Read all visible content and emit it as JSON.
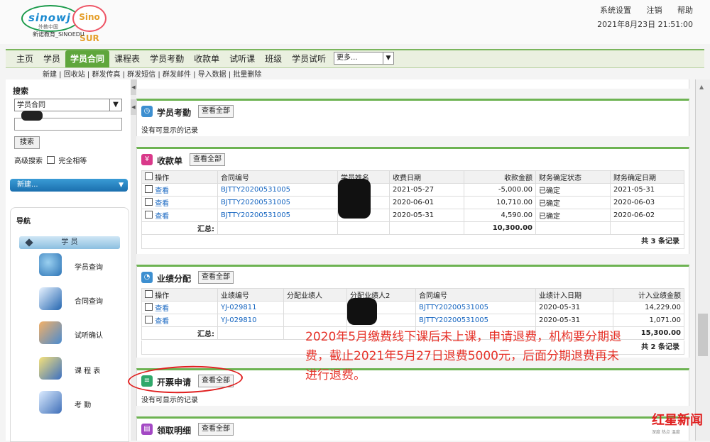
{
  "header": {
    "logo_text": "sinowj",
    "logo_sub": "外教中国",
    "badge": "Sino SUR",
    "tagline": "新诺教育_SINOEDU",
    "links": [
      "系统设置",
      "注销",
      "帮助"
    ],
    "datetime": "2021年8月23日 21:51:00"
  },
  "nav": {
    "items": [
      "主页",
      "学员",
      "学员合同",
      "课程表",
      "学员考勤",
      "收款单",
      "试听课",
      "班级",
      "学员试听"
    ],
    "active": "学员合同",
    "more": "更多..."
  },
  "subnav": "新建 | 回收站 | 群发传真 | 群发短信 | 群发邮件 | 导入数据 | 批量删除",
  "sidebar": {
    "search_title": "搜索",
    "search_select": "学员合同",
    "search_button": "搜索",
    "advanced": "高级搜索",
    "exact": "完全相等",
    "new_label": "新建...",
    "nav_title": "导航",
    "section": "学 员",
    "items": [
      "学员查询",
      "合同查询",
      "试听确认",
      "课 程 表",
      "考 勤"
    ]
  },
  "colors": {
    "accent": "#5fa63c",
    "link": "#1565c0",
    "annotation": "#e6332a"
  },
  "panels": {
    "attendance": {
      "title": "学员考勤",
      "button": "查看全部",
      "empty": "没有可显示的记录"
    },
    "receipts": {
      "title": "收款单",
      "button": "查看全部",
      "headers": [
        "操作",
        "合同编号",
        "学员姓名",
        "收费日期",
        "收款金额",
        "财务确定状态",
        "财务确定日期"
      ],
      "rows": [
        {
          "action": "查看",
          "contract": "BJTTY20200531005",
          "date": "2021-05-27",
          "amount": "-5,000.00",
          "status": "已确定",
          "confirm": "2021-05-31"
        },
        {
          "action": "查看",
          "contract": "BJTTY20200531005",
          "date": "2020-06-01",
          "amount": "10,710.00",
          "status": "已确定",
          "confirm": "2020-06-03"
        },
        {
          "action": "查看",
          "contract": "BJTTY20200531005",
          "date": "2020-05-31",
          "amount": "4,590.00",
          "status": "已确定",
          "confirm": "2020-06-02"
        }
      ],
      "total_label": "汇总:",
      "total": "10,300.00",
      "count": "共 3 条记录"
    },
    "performance": {
      "title": "业绩分配",
      "button": "查看全部",
      "headers": [
        "操作",
        "业绩编号",
        "分配业绩人",
        "分配业绩人2",
        "合同编号",
        "业绩计入日期",
        "计入业绩金额"
      ],
      "rows": [
        {
          "action": "查看",
          "code": "YJ-029811",
          "contract": "BJTTY20200531005",
          "date": "2020-05-31",
          "amount": "14,229.00"
        },
        {
          "action": "查看",
          "code": "YJ-029810",
          "contract": "BJTTY20200531005",
          "date": "2020-05-31",
          "amount": "1,071.00"
        }
      ],
      "total_label": "汇总:",
      "total": "15,300.00",
      "count": "共 2 条记录"
    },
    "invoice": {
      "title": "开票申请",
      "button": "查看全部",
      "empty": "没有可显示的记录"
    },
    "collection": {
      "title": "领取明细",
      "button": "查看全部"
    }
  },
  "annotation": "2020年5月缴费线下课后未上课，申请退费，机构要分期退费，截止2021年5月27日退费5000元，后面分期退费再未进行退费。",
  "watermark": {
    "main": "红星新闻",
    "sub": "深度 热点 温度"
  }
}
